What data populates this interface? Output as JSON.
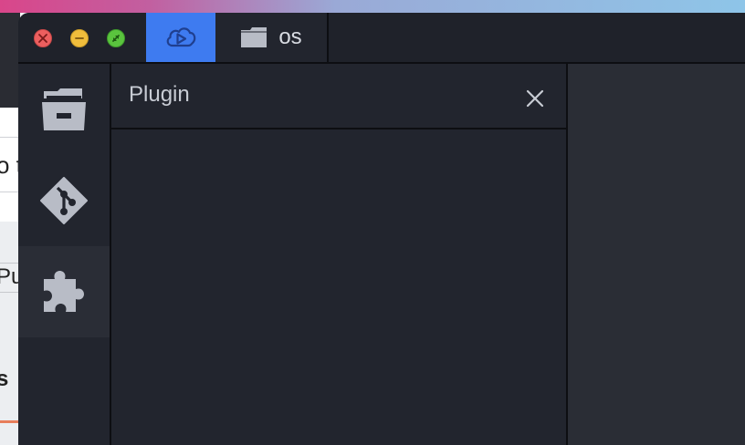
{
  "window": {
    "tabs": [
      {
        "icon": "cloud-play-icon",
        "label": "",
        "active": true
      },
      {
        "icon": "folder-icon",
        "label": "os",
        "active": false
      }
    ]
  },
  "sidebar": {
    "items": [
      {
        "icon": "file-drawer-icon",
        "active": false
      },
      {
        "icon": "git-icon",
        "active": false
      },
      {
        "icon": "puzzle-icon",
        "active": true
      }
    ]
  },
  "panel": {
    "title": "Plugin",
    "close_icon": "close-icon"
  },
  "background_window": {
    "fragments": [
      "o t",
      "Pu",
      "s"
    ]
  },
  "colors": {
    "accent": "#3e7bf0",
    "window_bg": "#22252e",
    "icon": "#b8bcc6",
    "close": "#ec5f5f",
    "minimize": "#f0bd3c",
    "maximize": "#5ac43e"
  }
}
